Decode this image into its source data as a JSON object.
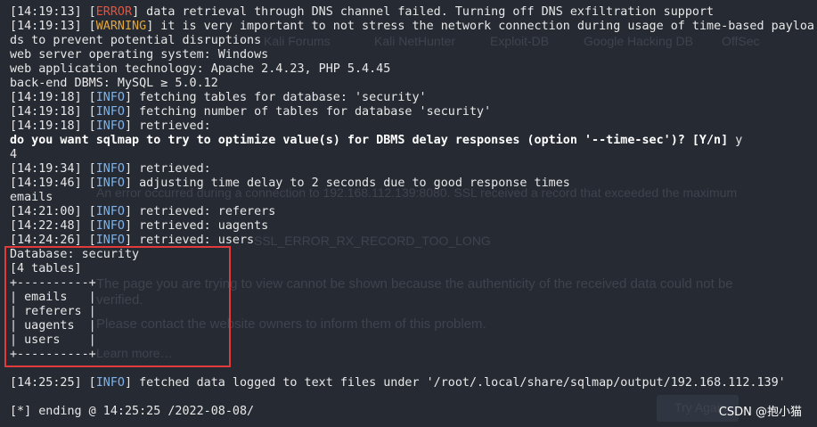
{
  "terminal": {
    "lines": [
      {
        "ts": "14:19:13",
        "lvl": "ERROR",
        "msg": " data retrieval through DNS channel failed. Turning off DNS exfiltration support"
      },
      {
        "ts": "14:19:13",
        "lvl": "WARNING",
        "msg": " it is very important to not stress the network connection during usage of time-based payloa"
      },
      {
        "text": "ds to prevent potential disruptions"
      },
      {
        "text": "web server operating system: Windows"
      },
      {
        "text": "web application technology: Apache 2.4.23, PHP 5.4.45"
      },
      {
        "text": "back-end DBMS: MySQL ≥ 5.0.12"
      },
      {
        "ts": "14:19:18",
        "lvl": "INFO",
        "msg": " fetching tables for database: 'security'"
      },
      {
        "ts": "14:19:18",
        "lvl": "INFO",
        "msg": " fetching number of tables for database 'security'"
      },
      {
        "ts": "14:19:18",
        "lvl": "INFO",
        "msg": " retrieved:"
      },
      {
        "prompt": "do you want sqlmap to try to optimize value(s) for DBMS delay responses (option '--time-sec')? [Y/n]",
        "answer": " y"
      },
      {
        "text": "4"
      },
      {
        "ts": "14:19:34",
        "lvl": "INFO",
        "msg": " retrieved:"
      },
      {
        "ts": "14:19:46",
        "lvl": "INFO",
        "msg": " adjusting time delay to 2 seconds due to good response times"
      },
      {
        "text": "emails"
      },
      {
        "ts": "14:21:00",
        "lvl": "INFO",
        "msg": " retrieved: referers"
      },
      {
        "ts": "14:22:48",
        "lvl": "INFO",
        "msg": " retrieved: uagents"
      },
      {
        "ts": "14:24:26",
        "lvl": "INFO",
        "msg": " retrieved: users"
      },
      {
        "text": "Database: security"
      },
      {
        "text": "[4 tables]"
      },
      {
        "text": "+----------+"
      },
      {
        "text": "| emails   |"
      },
      {
        "text": "| referers |"
      },
      {
        "text": "| uagents  |"
      },
      {
        "text": "| users    |"
      },
      {
        "text": "+----------+"
      },
      {
        "text": ""
      },
      {
        "ts": "14:25:25",
        "lvl": "INFO",
        "msg": " fetched data logged to text files under '/root/.local/share/sqlmap/output/192.168.112.139'"
      },
      {
        "text": ""
      },
      {
        "text": "[*] ending @ 14:25:25 /2022-08-08/"
      }
    ]
  },
  "background": {
    "bookmarks": [
      "Kali Forums",
      "Kali NetHunter",
      "Exploit-DB",
      "Google Hacking DB",
      "OffSec"
    ],
    "error_text_1": "An error occurred during a connection to 192.168.112.139:8080. SSL received a record that exceeded the maximum",
    "error_code": "SSL_ERROR_RX_RECORD_TOO_LONG",
    "bullet_1": "The page you are trying to view cannot be shown because the authenticity of the received data could not be",
    "bullet_1b": "verified.",
    "bullet_2": "Please contact the website owners to inform them of this problem.",
    "learn_more": "Learn more…",
    "try_again": "Try Again"
  },
  "watermark": "CSDN @抱小猫"
}
